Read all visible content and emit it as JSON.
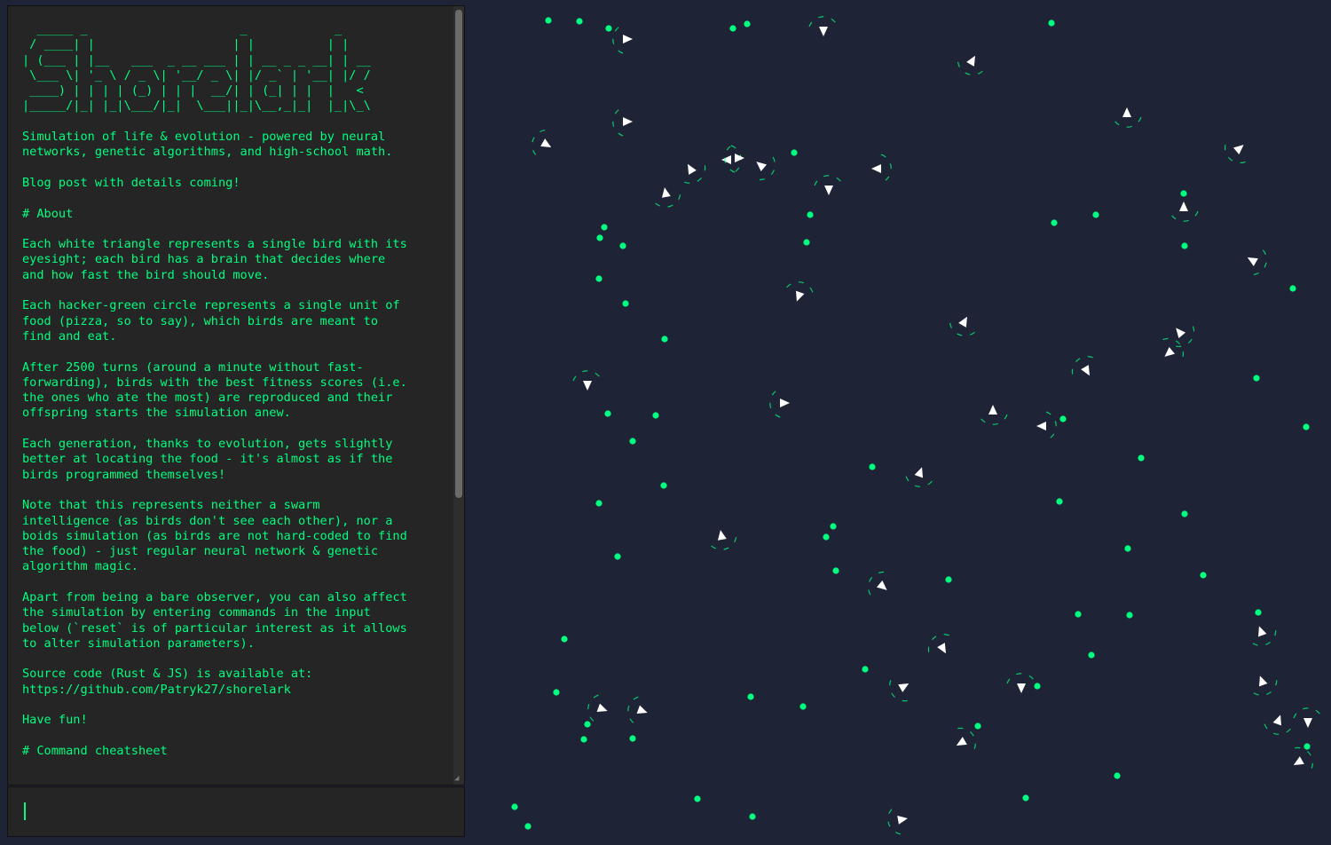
{
  "terminal": {
    "logo_lines": [
      "  _____ _                     _            _    ",
      " / ____| |                   | |          | |   ",
      "| (___ | |__   ___  _ __ ___ | | __ _ _ __| | __",
      " \\___ \\| '_ \\ / _ \\| '__/ _ \\| |/ _` | '__| |/ /",
      " ____) | | | | (_) | | |  __/| | (_| | |  |   < ",
      "|_____/|_| |_|\\___/|_|  \\___||_|\\__,_|_|  |_|\\_\\"
    ],
    "body": "Simulation of life & evolution - powered by neural\nnetworks, genetic algorithms, and high-school math.\n\nBlog post with details coming!\n\n# About\n\nEach white triangle represents a single bird with its\neyesight; each bird has a brain that decides where\nand how fast the bird should move.\n\nEach hacker-green circle represents a single unit of\nfood (pizza, so to say), which birds are meant to\nfind and eat.\n\nAfter 2500 turns (around a minute without fast-\nforwarding), birds with the best fitness scores (i.e.\nthe ones who ate the most) are reproduced and their\noffspring starts the simulation anew.\n\nEach generation, thanks to evolution, gets slightly\nbetter at locating the food - it's almost as if the\nbirds programmed themselves!\n\nNote that this represents neither a swarm\nintelligence (as birds don't see each other), nor a\nboids simulation (as birds are not hard-coded to find\nthe food) - just regular neural network & genetic\nalgorithm magic.\n\nApart from being a bare observer, you can also affect\nthe simulation by entering commands in the input\nbelow (`reset` is of particular interest as it allows\nto alter simulation parameters).\n\nSource code (Rust & JS) is available at:\nhttps://github.com/Patryk27/shorelark\n\nHave fun!\n\n# Command cheatsheet"
  },
  "command": {
    "value": "",
    "placeholder": ""
  },
  "simulation": {
    "colors": {
      "background": "#1f2336",
      "food": "#00ff7f",
      "bird": "#ffffff",
      "eyesight": "#00ff7f"
    }
  }
}
